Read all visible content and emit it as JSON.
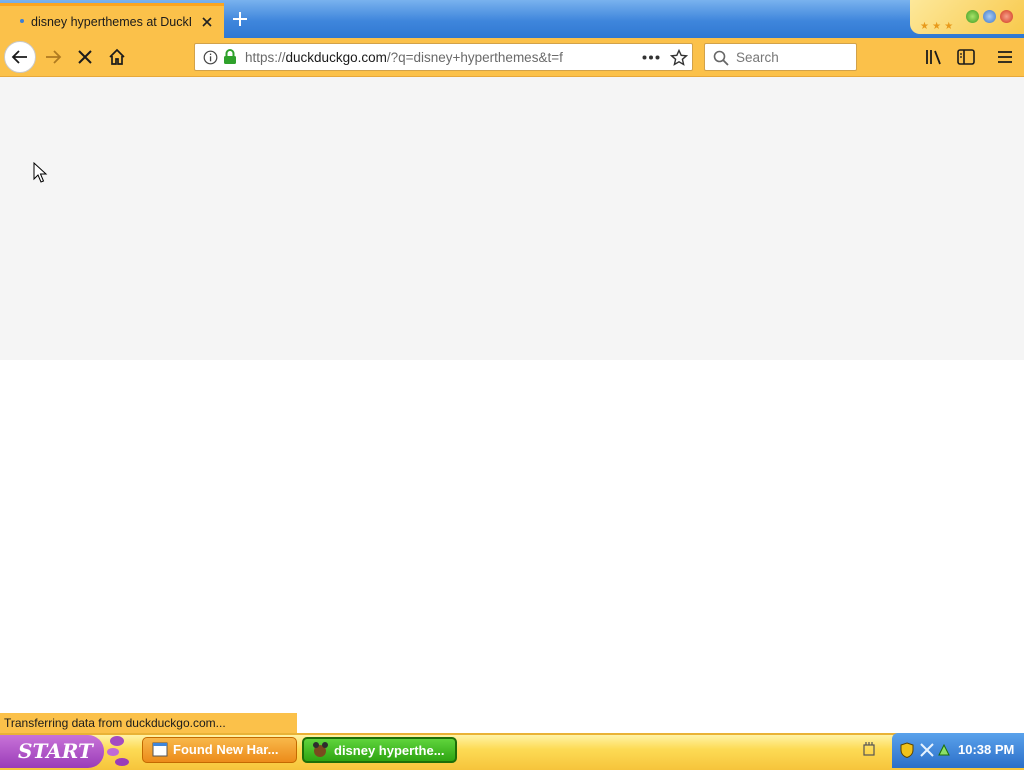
{
  "browser": {
    "tab": {
      "title": "disney hyperthemes at DuckDuckGo"
    },
    "url": {
      "prefix": "https://",
      "domain": "duckduckgo.com",
      "path": "/?q=disney+hyperthemes&t=f"
    },
    "search": {
      "placeholder": "Search"
    },
    "status": "Transferring data from duckduckgo.com..."
  },
  "taskbar": {
    "start_label": "START",
    "tasks": [
      {
        "label": "Found New Har..."
      },
      {
        "label": "disney hyperthe..."
      }
    ],
    "clock": "10:38 PM"
  },
  "colors": {
    "toolbar": "#fbc14a",
    "tabstrip": "#3f86dc",
    "start": "#9a3cb8",
    "active_task": "#2ea412"
  },
  "icons": [
    "back-arrow-icon",
    "forward-arrow-icon",
    "stop-icon",
    "home-icon",
    "info-icon",
    "lock-icon",
    "more-actions-icon",
    "bookmark-star-icon",
    "search-icon",
    "library-icon",
    "sidebar-icon",
    "menu-icon"
  ]
}
